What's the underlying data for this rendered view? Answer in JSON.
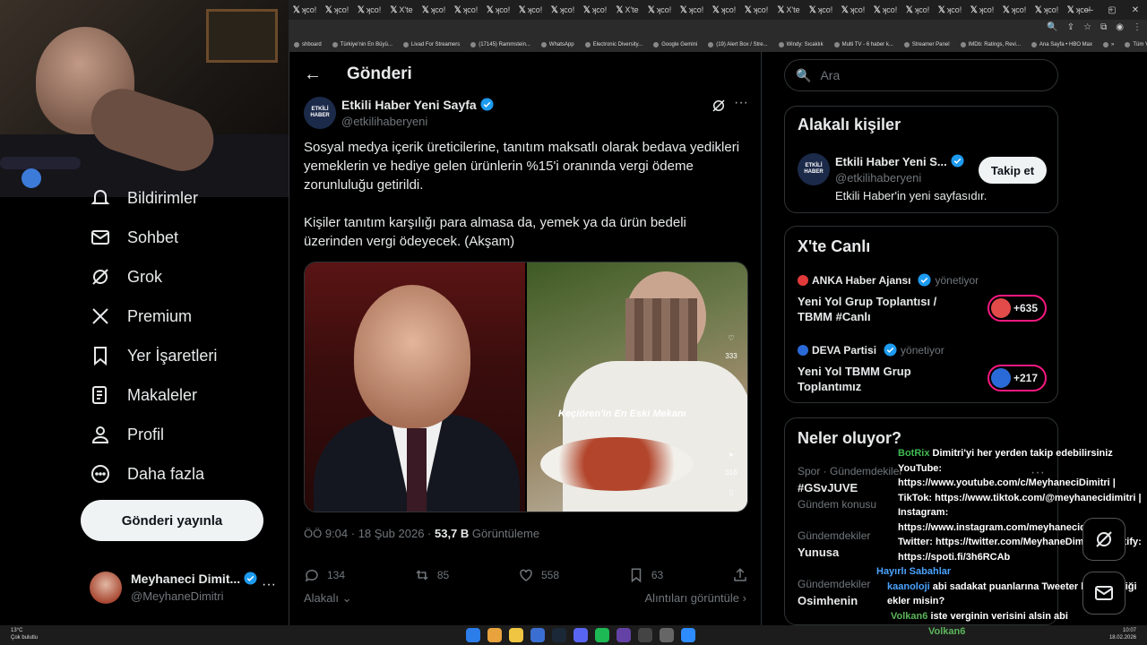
{
  "browser": {
    "tabs": [
      "ʞco!",
      "ʞco!",
      "ʞco!",
      "X'te",
      "ʞco!",
      "ʞco!",
      "ʞco!",
      "ʞco!",
      "ʞco!",
      "ʞco!",
      "X'te",
      "ʞco!",
      "ʞco!",
      "ʞco!",
      "ʞco!",
      "X'te",
      "ʞco!",
      "ʞco!",
      "ʞco!",
      "ʞco!",
      "ʞco!",
      "ʞco!",
      "ʞco!",
      "ʞco!",
      "ʞco!"
    ],
    "bookmarks": [
      "shboard",
      "Türkiye'nin En Büyü...",
      "Livad For Streamers",
      "(17145) Rammstein...",
      "WhatsApp",
      "Electronic Diversity...",
      "Google Gemini",
      "(19) Alert Box / Stre...",
      "Windy: Sıcaklık",
      "Multi TV - 6 haber k...",
      "Streamer Panel",
      "IMDb: Ratings, Revi...",
      "Ana Sayfa • HBO Max",
      "»",
      "Tüm Yer İşaretleri"
    ]
  },
  "nav": {
    "items": [
      {
        "label": "Bildirimler",
        "icon": "bell-icon"
      },
      {
        "label": "Sohbet",
        "icon": "mail-icon"
      },
      {
        "label": "Grok",
        "icon": "grok-icon"
      },
      {
        "label": "Premium",
        "icon": "x-logo-icon"
      },
      {
        "label": "Yer İşaretleri",
        "icon": "bookmark-icon"
      },
      {
        "label": "Makaleler",
        "icon": "article-icon"
      },
      {
        "label": "Profil",
        "icon": "person-icon"
      },
      {
        "label": "Daha fazla",
        "icon": "more-circle-icon"
      }
    ],
    "post_button": "Gönderi yayınla",
    "account": {
      "name": "Meyhaneci Dimit...",
      "handle": "@MeyhaneDimitri",
      "more": "···"
    }
  },
  "header": {
    "title": "Gönderi"
  },
  "tweet": {
    "author": {
      "name": "Etkili Haber Yeni Sayfa",
      "handle": "@etkilihaberyeni",
      "avatar_text": "ETKİLİ HABER"
    },
    "text_p1": "Sosyal medya içerik üreticilerine, tanıtım maksatlı olarak bedava yedikleri yemeklerin ve hediye gelen ürünlerin %15'i oranında vergi ödeme zorunluluğu getirildi.",
    "text_p2": "Kişiler tanıtım karşılığı para almasa da, yemek ya da ürün bedeli üzerinden vergi ödeyecek. (Akşam)",
    "media": {
      "caption": "Keçiören'in En Eski Mekanı",
      "side_count_1": "333",
      "side_count_2": "316"
    },
    "time": "ÖÖ 9:04 · 18 Şub 2026 · ",
    "views_value": "53,7 B",
    "views_label": " Görüntüleme",
    "replies": "134",
    "reposts": "85",
    "likes": "558",
    "bookmarks": "63",
    "related": "Alakalı",
    "quotes": "Alıntıları görüntüle"
  },
  "search": {
    "placeholder": "Ara"
  },
  "related_people": {
    "title": "Alakalı kişiler",
    "name": "Etkili Haber Yeni S...",
    "handle": "@etkilihaberyeni",
    "bio": "Etkili Haber'in yeni sayfasıdır.",
    "follow": "Takip et"
  },
  "live": {
    "title": "X'te Canlı",
    "items": [
      {
        "host": "ANKA Haber Ajansı",
        "role": "yönetiyor",
        "title": "Yeni Yol Grup Toplantısı / TBMM #Canlı",
        "count": "+635"
      },
      {
        "host": "DEVA Partisi",
        "role": "yönetiyor",
        "title": "Yeni Yol TBMM Grup Toplantımız",
        "count": "+217"
      }
    ]
  },
  "trends": {
    "title": "Neler oluyor?",
    "items": [
      {
        "context": "Spor · Gündemdekiler",
        "name": "#GSvJUVE",
        "extra": "Gündem konusu "
      },
      {
        "context": "Gündemdekiler",
        "name": "Yunusa"
      },
      {
        "context": "Gündemdekiler",
        "name": "Osimhenin"
      }
    ],
    "more": "···"
  },
  "chat": [
    {
      "user": "BotRix",
      "color": "#3fb950",
      "msg": "Dimitri'yi her yerden takip edebilirsiniz YouTube: https://www.youtube.com/c/MeyhaneciDimitri | TikTok: https://www.tiktok.com/@meyhanecidimitri | Instagram: https://www.instagram.com/meyhanecidimitri | Twitter: https://twitter.com/MeyhaneDimitri | Spotify: https://spoti.fi/3h6RCAb"
    },
    {
      "user": "Hayırlı Sabahlar",
      "color": "#4aa3ff",
      "msg": ""
    },
    {
      "user": "kaanoloji",
      "color": "#4aa3ff",
      "msg": "abi sadakat puanlarına Tweeter linki özelliği ekler misin?"
    },
    {
      "user": "Volkan6",
      "color": "#5bb45b",
      "msg": "iste verginin verisini alsin abi"
    }
  ],
  "streamer_name": "Volkan6",
  "taskbar": {
    "weather_temp": "13°C",
    "weather_desc": "Çok bulutlu",
    "time": "10:07",
    "date": "18.02.2026"
  },
  "colors": {
    "accent": "#1d9bf0",
    "live": "#f91880"
  }
}
